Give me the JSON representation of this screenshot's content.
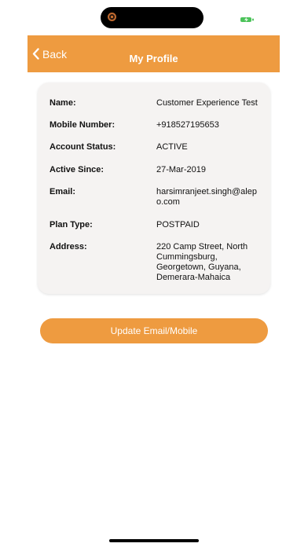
{
  "status_bar": {
    "battery_icon": "battery-charging-icon",
    "battery_color": "#4cc35a"
  },
  "header": {
    "back_label": "Back",
    "back_icon": "chevron-left-icon",
    "title": "My Profile",
    "background_color": "#ee9b40"
  },
  "profile": {
    "rows": [
      {
        "label": "Name:",
        "value": "Customer Experience Test"
      },
      {
        "label": "Mobile Number:",
        "value": "+918527195653"
      },
      {
        "label": "Account Status:",
        "value": "ACTIVE"
      },
      {
        "label": "Active Since:",
        "value": "27-Mar-2019"
      },
      {
        "label": "Email:",
        "value": "harsimranjeet.singh@alepo.com"
      },
      {
        "label": "Plan Type:",
        "value": "POSTPAID"
      },
      {
        "label": "Address:",
        "value": "220 Camp Street, North Cummingsburg, Georgetown, Guyana, Demerara-Mahaica"
      }
    ]
  },
  "actions": {
    "update_label": "Update Email/Mobile"
  }
}
